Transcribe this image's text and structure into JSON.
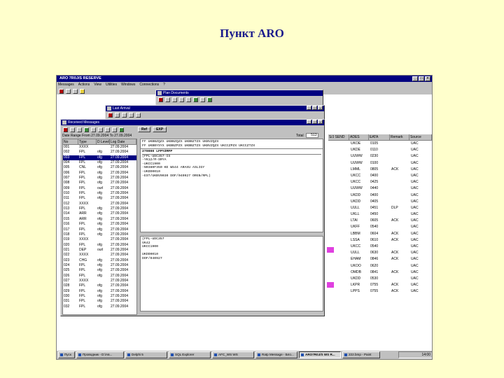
{
  "slide_title": "Пункт ARO",
  "app": {
    "title": "ARO 7R0J/S RESERVE",
    "menu": [
      "Messages",
      "Actions",
      "View",
      "Utilities",
      "Windows",
      "Connections",
      "?"
    ]
  },
  "background_grid": {
    "columns": [
      "S/J SEND",
      "ADES",
      "EATA",
      "Remark",
      "Source"
    ],
    "rows": [
      [
        "",
        "UKOE",
        "0105",
        "",
        "UAC"
      ],
      [
        "",
        "UKDE",
        "0110",
        "",
        "UAC"
      ],
      [
        "",
        "UUWW",
        "0230",
        "",
        "UAC"
      ],
      [
        "",
        "UUWW",
        "0100",
        "",
        "UAC"
      ],
      [
        "",
        "LMML",
        "0805",
        "ACK",
        "UAC"
      ],
      [
        "",
        "UKCC",
        "0400",
        "",
        "UAC"
      ],
      [
        "",
        "UKCC",
        "0425",
        "",
        "UAC"
      ],
      [
        "",
        "UUWW",
        "0440",
        "",
        "UAC"
      ],
      [
        "",
        "UKDD",
        "0400",
        "",
        "UAC"
      ],
      [
        "",
        "UKDD",
        "0405",
        "",
        "UAC"
      ],
      [
        "",
        "UULL",
        "0451",
        "DLP",
        "UAC"
      ],
      [
        "",
        "UKLL",
        "0450",
        "",
        "UAC"
      ],
      [
        "",
        "LTAI",
        "0605",
        "ACK",
        "UAC"
      ],
      [
        "",
        "UKFF",
        "0540",
        "",
        "UAC"
      ],
      [
        "",
        "LBBM",
        "0604",
        "ACK",
        "UAC"
      ],
      [
        "",
        "LSSA",
        "0610",
        "ACK",
        "UAC"
      ],
      [
        "",
        "UKCC",
        "0540",
        "",
        "UAC"
      ],
      [
        "",
        "UULL",
        "0630",
        "ACK",
        "UAC"
      ],
      [
        "",
        "EHAM",
        "0846",
        "ACK",
        "UAC"
      ],
      [
        "",
        "UKOO",
        "0620",
        "",
        "UAC"
      ],
      [
        "",
        "OMDB",
        "0841",
        "ACK",
        "UAC"
      ],
      [
        "",
        "UKDD",
        "0530",
        "",
        "UAC"
      ],
      [
        "",
        "LKPR",
        "0755",
        "ACK",
        "UAC"
      ],
      [
        "",
        "LPPS",
        "0755",
        "ACK",
        "UAC"
      ]
    ]
  },
  "plan_window": {
    "title": "Plan Documents"
  },
  "last_arrivals_window": {
    "title": "Last Arrival"
  },
  "received_messages": {
    "title": "Received Messages",
    "buttons": [
      "Ref",
      "EXP"
    ],
    "date_range": "Date Range From 27.09.2004 To 27.09.2004",
    "total_label": "Total",
    "total_value": "513",
    "columns": [
      "No",
      "Type",
      "D Level",
      "Log Date"
    ],
    "rows": [
      [
        "001",
        "XXXX",
        "",
        "27.09.2004"
      ],
      [
        "002",
        "FPL",
        "ofg",
        "27.09.2004"
      ],
      [
        "003",
        "FPL",
        "ofg",
        "27.09.2004"
      ],
      [
        "004",
        "FPL",
        "ofg",
        "27.09.2004"
      ],
      [
        "005",
        "CNL",
        "ofg",
        "27.09.2004"
      ],
      [
        "006",
        "FPL",
        "ofg",
        "27.09.2004"
      ],
      [
        "007",
        "FPL",
        "ofg",
        "27.09.2004"
      ],
      [
        "008",
        "FPL",
        "ofg",
        "27.09.2004"
      ],
      [
        "009",
        "FPL",
        "ourl",
        "27.09.2004"
      ],
      [
        "010",
        "FPL",
        "ofg",
        "27.09.2004"
      ],
      [
        "011",
        "FPL",
        "ofg",
        "27.09.2004"
      ],
      [
        "012",
        "XXXX",
        "",
        "27.09.2004"
      ],
      [
        "013",
        "FPL",
        "ofg",
        "27.09.2004"
      ],
      [
        "014",
        "ARR",
        "ofg",
        "27.09.2004"
      ],
      [
        "015",
        "ARR",
        "ofg",
        "27.09.2004"
      ],
      [
        "016",
        "FPL",
        "ofg",
        "27.09.2004"
      ],
      [
        "017",
        "FPL",
        "ofg",
        "27.09.2004"
      ],
      [
        "018",
        "FPL",
        "ofg",
        "27.09.2004"
      ],
      [
        "019",
        "XXXX",
        "",
        "27.09.2004"
      ],
      [
        "020",
        "FPL",
        "ofg",
        "27.09.2004"
      ],
      [
        "021",
        "DEP",
        "ourl",
        "27.09.2004"
      ],
      [
        "022",
        "XXXX",
        "",
        "27.09.2004"
      ],
      [
        "023",
        "CHG",
        "ofg",
        "27.09.2004"
      ],
      [
        "024",
        "FPL",
        "ofg",
        "27.09.2004"
      ],
      [
        "025",
        "FPL",
        "ofg",
        "27.09.2004"
      ],
      [
        "026",
        "FPL",
        "ofg",
        "27.09.2004"
      ],
      [
        "027",
        "XXXX",
        "",
        "27.09.2004"
      ],
      [
        "028",
        "FPL",
        "ofg",
        "27.09.2004"
      ],
      [
        "029",
        "FPL",
        "ofg",
        "27.09.2004"
      ],
      [
        "030",
        "FPL",
        "ofg",
        "27.09.2004"
      ],
      [
        "031",
        "FPL",
        "ofg",
        "27.09.2004"
      ],
      [
        "032",
        "FPL",
        "ofg",
        "27.09.2004"
      ]
    ],
    "selected_row": 2,
    "addresses": "FF UKBBZQZX UKBBZQZX UKBBZTZX UKBVZQZX\nFF UKBBYSYX UKBBZPZX UKBBZTZX UKBVZQZX UKCCZPZX UKCCZTZX",
    "message_header": "270000 LFPYZMFP",
    "message_text": "(FPL-UDC357-IS\n-YK12/M-SRYA\n-UKCC1900\n-N0380F350 KE W544 ARAXU ASLIGY\n-UKDD0010\n-EST/UKBV0030 DOF/040927 ORGN/RPL)",
    "decoded_text": "(FPL-UDC357\nVK42\nUKCC1900\n\nUKDD0010\nDOF/040927"
  },
  "taskbar": {
    "start": "Пуск",
    "tasks": [
      "Проводник - D:\\Ав...",
      "Delphi 5",
      "SQL Explorer",
      "AFC_WS WS",
      "Ratp Message - Бло...",
      "ARO7R0J/S WS R...",
      "222.bmp - Paint"
    ],
    "active_index": 5,
    "clock": "14:00"
  }
}
